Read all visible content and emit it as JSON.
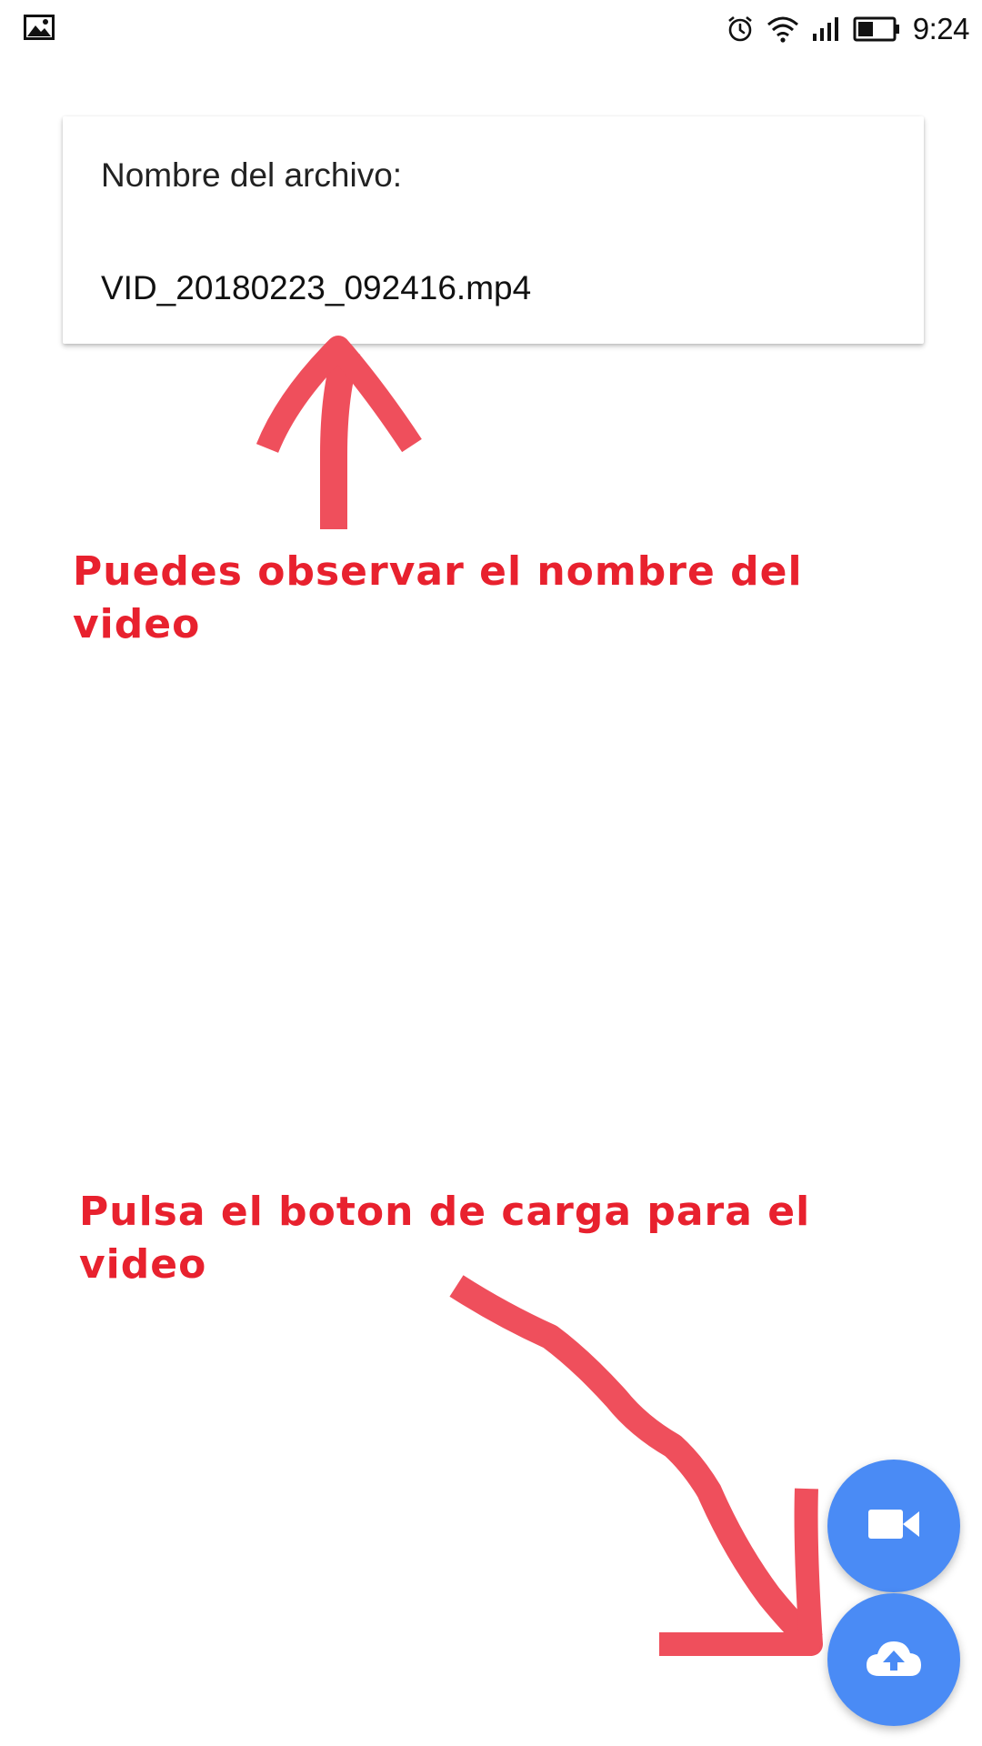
{
  "status_bar": {
    "time": "9:24",
    "icons": [
      "image-notification-icon",
      "alarm-icon",
      "wifi-icon",
      "signal-icon",
      "battery-icon"
    ]
  },
  "file_card": {
    "label": "Nombre del archivo:",
    "file_name": "VID_20180223_092416.mp4"
  },
  "annotations": {
    "top_line1": "Puedes observar el nombre del",
    "top_line2": "video",
    "bottom_line1": "Pulsa el boton de carga para el",
    "bottom_line2": "video",
    "color": "#e8212e"
  },
  "fabs": {
    "video_icon": "videocam-icon",
    "upload_icon": "cloud-upload-icon",
    "color": "#4a8bf5"
  }
}
